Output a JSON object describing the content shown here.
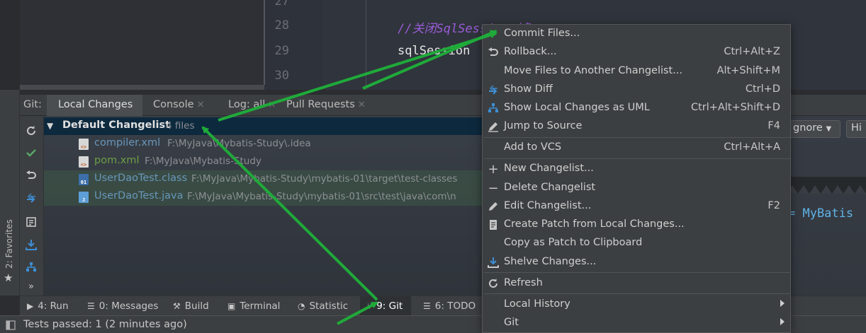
{
  "editor": {
    "line_numbers": [
      "27",
      "28",
      "29",
      "30"
    ],
    "comment_line": "//关闭SqlSession对象",
    "code_line": "sqlSession",
    "right_code": "= MyBatis"
  },
  "tool_window": {
    "label": "Git:",
    "tabs": [
      {
        "label": "Local Changes",
        "closable": false,
        "active": true
      },
      {
        "label": "Console",
        "closable": true
      },
      {
        "label": "Log: all",
        "closable": true
      },
      {
        "label": "Pull Requests",
        "closable": true
      }
    ],
    "right_buttons": [
      "gnore",
      "Hi"
    ]
  },
  "changelist": {
    "name": "Default Changelist",
    "count": "4 files",
    "files": [
      {
        "name": "compiler.xml",
        "path": "F:\\MyJava\\Mybatis-Study\\.idea",
        "color": "#6897bb",
        "icon": "xml-file-icon"
      },
      {
        "name": "pom.xml",
        "path": "F:\\MyJava\\Mybatis-Study",
        "color": "#6a9f45",
        "icon": "xml-file-icon"
      },
      {
        "name": "UserDaoTest.class",
        "path": "F:\\MyJava\\Mybatis-Study\\mybatis-01\\target\\test-classes",
        "color": "#6897bb",
        "icon": "class-file-icon"
      },
      {
        "name": "UserDaoTest.java",
        "path": "F:\\MyJava\\Mybatis-Study\\mybatis-01\\src\\test\\java\\com\\n",
        "color": "#6897bb",
        "icon": "java-file-icon"
      }
    ]
  },
  "menu": {
    "items": [
      {
        "label": "Commit Files...",
        "icon": "",
        "shortcut": "",
        "highlighted": true
      },
      {
        "label": "Rollback...",
        "icon": "rollback-icon",
        "shortcut": "Ctrl+Alt+Z"
      },
      {
        "label": "Move Files to Another Changelist...",
        "icon": "",
        "shortcut": "Alt+Shift+M"
      },
      {
        "label": "Show Diff",
        "icon": "diff-icon",
        "shortcut": "Ctrl+D"
      },
      {
        "label": "Show Local Changes as UML",
        "icon": "uml-icon",
        "shortcut": "Ctrl+Alt+Shift+D"
      },
      {
        "label": "Jump to Source",
        "icon": "edit-icon",
        "shortcut": "F4"
      },
      {
        "label": "Add to VCS",
        "icon": "",
        "shortcut": "Ctrl+Alt+A"
      },
      {
        "label": "New Changelist...",
        "icon": "plus-icon",
        "shortcut": ""
      },
      {
        "label": "Delete Changelist",
        "icon": "minus-icon",
        "shortcut": ""
      },
      {
        "label": "Edit Changelist...",
        "icon": "edit-icon",
        "shortcut": "F2"
      },
      {
        "label": "Create Patch from Local Changes...",
        "icon": "patch-icon",
        "shortcut": ""
      },
      {
        "label": "Copy as Patch to Clipboard",
        "icon": "",
        "shortcut": ""
      },
      {
        "label": "Shelve Changes...",
        "icon": "shelve-icon",
        "shortcut": ""
      },
      {
        "label": "Refresh",
        "icon": "refresh-icon",
        "shortcut": ""
      },
      {
        "label": "Local History",
        "icon": "",
        "submenu": true
      },
      {
        "label": "Git",
        "icon": "",
        "submenu": true
      }
    ]
  },
  "bottom_bar": {
    "items": [
      {
        "label": "4: Run",
        "icon": "run-icon"
      },
      {
        "label": "0: Messages",
        "icon": "messages-icon"
      },
      {
        "label": "Build",
        "icon": "build-icon"
      },
      {
        "label": "Terminal",
        "icon": "terminal-icon"
      },
      {
        "label": "Statistic",
        "icon": "statistic-icon"
      },
      {
        "label": "9: Git",
        "icon": "git-icon",
        "active": true
      },
      {
        "label": "6: TODO",
        "icon": "todo-icon"
      }
    ]
  },
  "favorites_label": "2: Favorites",
  "status": {
    "text": "Tests passed: 1 (2 minutes ago)"
  },
  "colors": {
    "annotation_arrow": "#1faa3a",
    "selection": "#0d293e",
    "accent": "#3592c4"
  }
}
